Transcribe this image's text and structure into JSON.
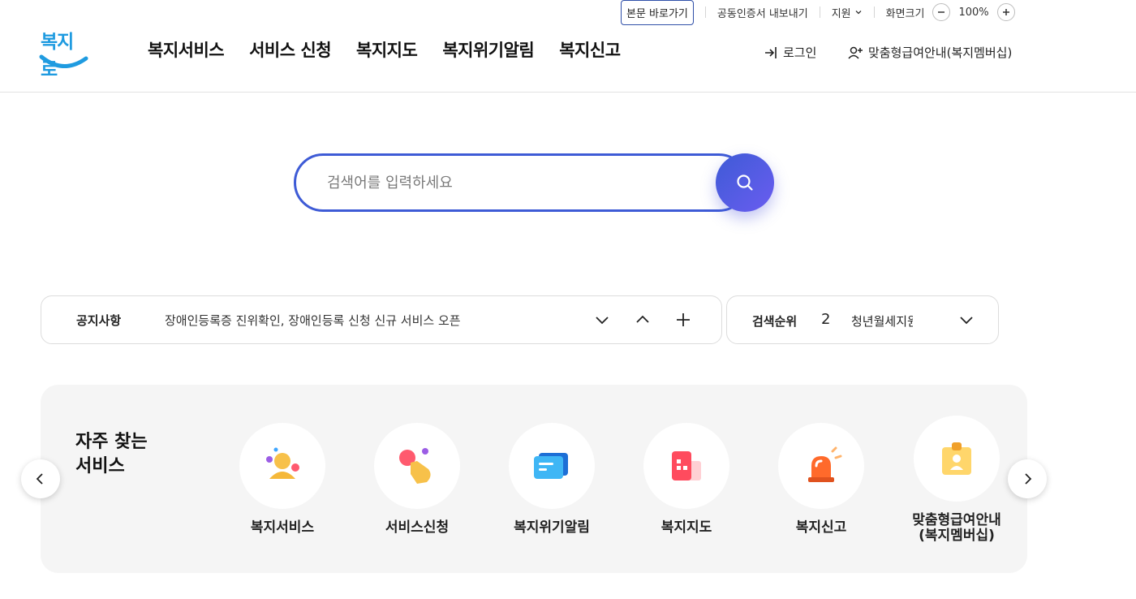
{
  "utility": {
    "skip_link": "본문 바로가기",
    "certificate_export": "공동인증서 내보내기",
    "support": "지원",
    "screen_size_label": "화면크기",
    "zoom_level": "100%"
  },
  "header": {
    "logo_text": "복지로",
    "nav": [
      "복지서비스",
      "서비스 신청",
      "복지지도",
      "복지위기알림",
      "복지신고"
    ],
    "login": "로그인",
    "membership": "맞춤형급여안내(복지멤버십)"
  },
  "search": {
    "placeholder": "검색어를 입력하세요"
  },
  "notice": {
    "title": "공지사항",
    "text": "장애인등록증 진위확인, 장애인등록 신청 신규 서비스 오픈"
  },
  "ranking": {
    "title": "검색순위",
    "rank": "2",
    "term": "청년월세지원"
  },
  "services": {
    "title_line1": "자주 찾는",
    "title_line2": "서비스",
    "items": [
      {
        "label": "복지서비스",
        "icon": "person-icon"
      },
      {
        "label": "서비스신청",
        "icon": "tap-hand-icon"
      },
      {
        "label": "복지위기알림",
        "icon": "message-icon"
      },
      {
        "label": "복지지도",
        "icon": "map-building-icon"
      },
      {
        "label": "복지신고",
        "icon": "siren-icon"
      },
      {
        "label_line1": "맞춤형급여안내",
        "label_line2": "(복지멤버십)",
        "icon": "id-badge-icon"
      }
    ]
  },
  "colors": {
    "accent": "#3e5bd6",
    "logo": "#1f9be0",
    "panel_bg": "#f5f5f5"
  }
}
